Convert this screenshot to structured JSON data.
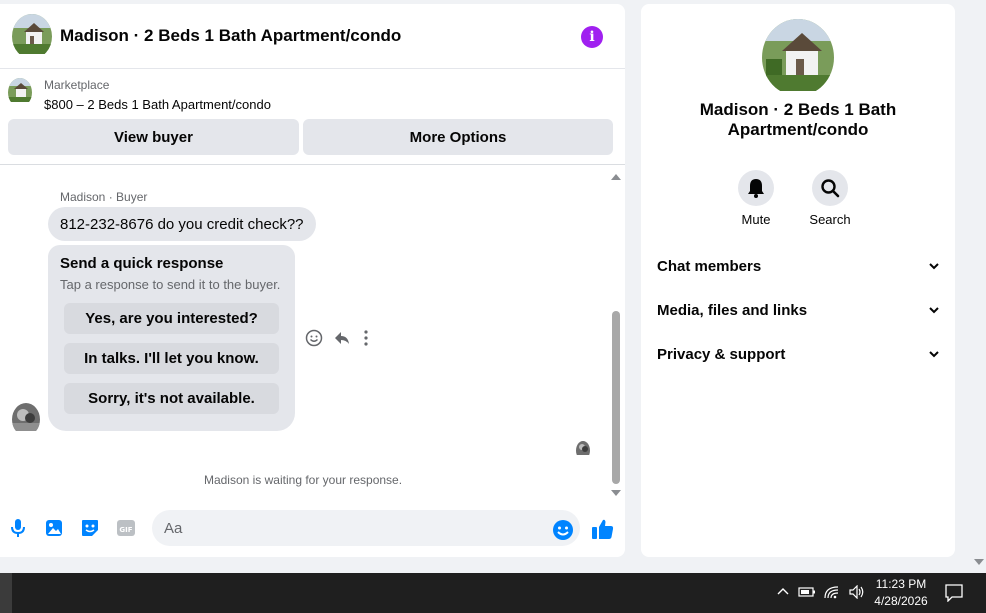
{
  "chat": {
    "title": "Madison · 2 Beds 1 Bath Apartment/condo",
    "marketplace_label": "Marketplace",
    "listing": "$800 – 2 Beds 1 Bath Apartment/condo",
    "view_buyer": "View buyer",
    "more_options": "More Options",
    "sender_label": "Madison · Buyer",
    "message": "812-232-8676 do you credit check??",
    "quick_response": {
      "title": "Send a quick response",
      "subtitle": "Tap a response to send it to the buyer.",
      "options": [
        "Yes, are you interested?",
        "In talks. I'll let you know.",
        "Sorry, it's not available."
      ]
    },
    "waiting": "Madison is waiting for your response.",
    "composer_placeholder": "Aa"
  },
  "info_panel": {
    "title": "Madison · 2 Beds 1 Bath Apartment/condo",
    "mute_label": "Mute",
    "search_label": "Search",
    "sections": [
      "Chat members",
      "Media, files and links",
      "Privacy & support"
    ]
  },
  "taskbar": {
    "time": "11:23 PM",
    "date": "4/28/2026"
  },
  "colors": {
    "accent_blue": "#0084ff",
    "info_purple": "#a020f0"
  }
}
